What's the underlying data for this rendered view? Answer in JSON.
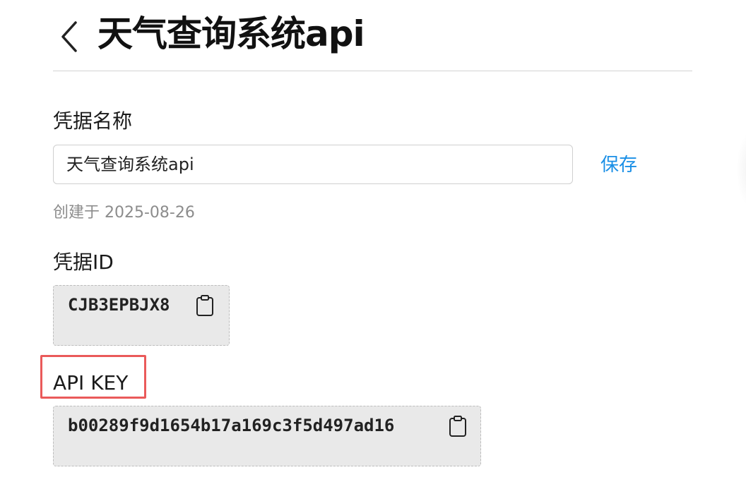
{
  "header": {
    "back_icon": "chevron-left-icon",
    "title": "天气查询系统api"
  },
  "credential_name": {
    "label": "凭据名称",
    "value": "天气查询系统api",
    "save_label": "保存"
  },
  "created": {
    "text": "创建于 2025-08-26"
  },
  "credential_id": {
    "label": "凭据ID",
    "value": "CJB3EPBJX8",
    "copy_icon": "clipboard-icon"
  },
  "api_key": {
    "label": "API KEY",
    "value": "b00289f9d1654b17a169c3f5d497ad16",
    "copy_icon": "clipboard-icon",
    "highlight_color": "#ea5a5a"
  },
  "colors": {
    "accent": "#1a8fe6",
    "muted_text": "#8c8c8c",
    "code_background": "#e9e9e9"
  }
}
